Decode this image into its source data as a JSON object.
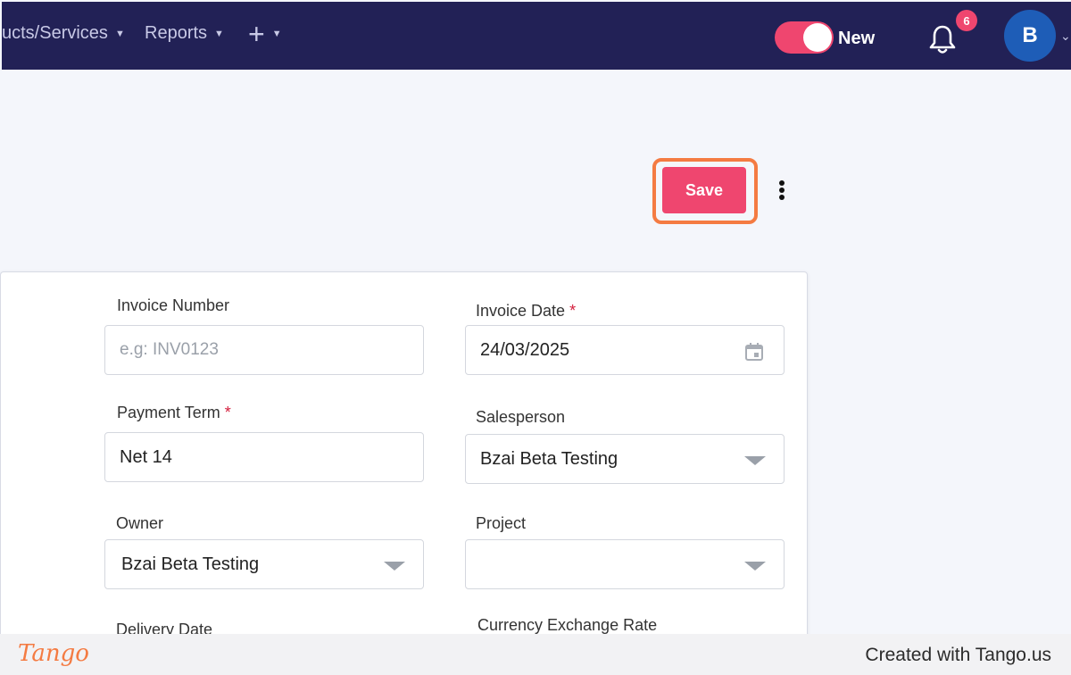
{
  "topbar": {
    "nav_items": [
      {
        "label": "ucts/Services"
      },
      {
        "label": "Reports"
      }
    ],
    "add_symbol": "+",
    "toggle_label": "New",
    "toggle_on": true,
    "notification_count": "6",
    "avatar_initial": "B",
    "bg_color": "#222156",
    "accent_color": "#ef466f"
  },
  "toolbar": {
    "save_label": "Save",
    "more_icon": "kebab-vertical-icon"
  },
  "form": {
    "invoice_number": {
      "label": "Invoice Number",
      "value": "",
      "placeholder": "e.g: INV0123"
    },
    "invoice_date": {
      "label": "Invoice Date",
      "required": "*",
      "value": "24/03/2025",
      "icon": "calendar-icon"
    },
    "payment_term": {
      "label": "Payment Term",
      "required": "*",
      "value": "Net 14"
    },
    "salesperson": {
      "label": "Salesperson",
      "value": "Bzai Beta Testing"
    },
    "owner": {
      "label": "Owner",
      "value": "Bzai Beta Testing"
    },
    "project": {
      "label": "Project",
      "value": ""
    },
    "delivery_date": {
      "label": "Delivery Date"
    },
    "currency_exchange_rate": {
      "label": "Currency Exchange Rate"
    }
  },
  "footer": {
    "logo_text": "Tango",
    "credit": "Created with Tango.us"
  }
}
